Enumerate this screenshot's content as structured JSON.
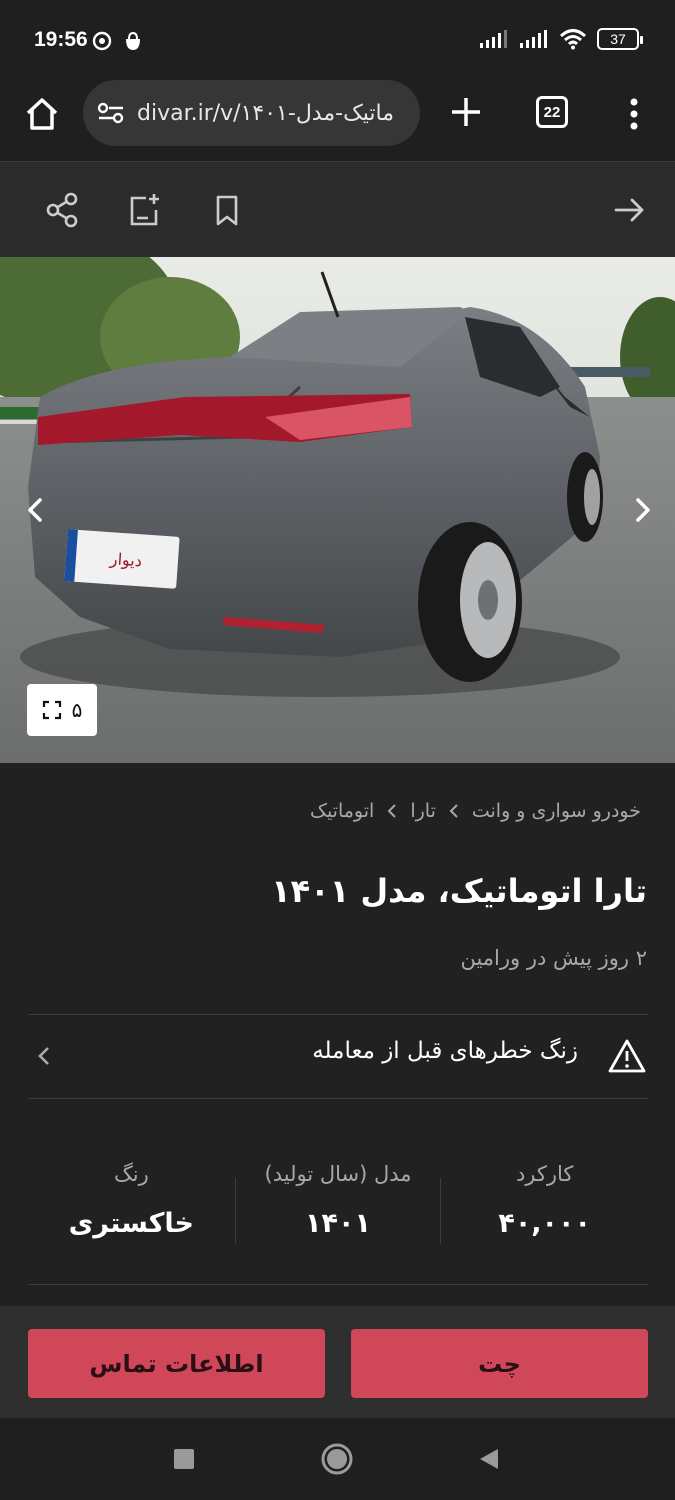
{
  "status_bar": {
    "time": "19:56",
    "battery": "37"
  },
  "browser": {
    "url": "divar.ir/v/ماتیک-مدل-۱۴۰۱",
    "tab_count": "22"
  },
  "toolbar": {
    "icons": [
      "share-icon",
      "add-note-icon",
      "bookmark-icon",
      "back-arrow-icon"
    ]
  },
  "gallery": {
    "count": "۵"
  },
  "breadcrumb": {
    "items": [
      "خودرو سواری و وانت",
      "تارا",
      "اتوماتیک"
    ]
  },
  "listing": {
    "title": "تارا اتوماتیک، مدل ۱۴۰۱",
    "subtitle": "۲ روز پیش در ورامین",
    "warning": "زنگ خطرهای قبل از معامله"
  },
  "stats": [
    {
      "label": "کارکرد",
      "value": "۴۰,۰۰۰"
    },
    {
      "label": "مدل (سال تولید)",
      "value": "۱۴۰۱"
    },
    {
      "label": "رنگ",
      "value": "خاکستری"
    }
  ],
  "actions": {
    "chat": "چت",
    "contact": "اطلاعات تماس"
  },
  "plate_text": "دیوار",
  "colors": {
    "accent": "#d0475a",
    "background": "#212121"
  }
}
